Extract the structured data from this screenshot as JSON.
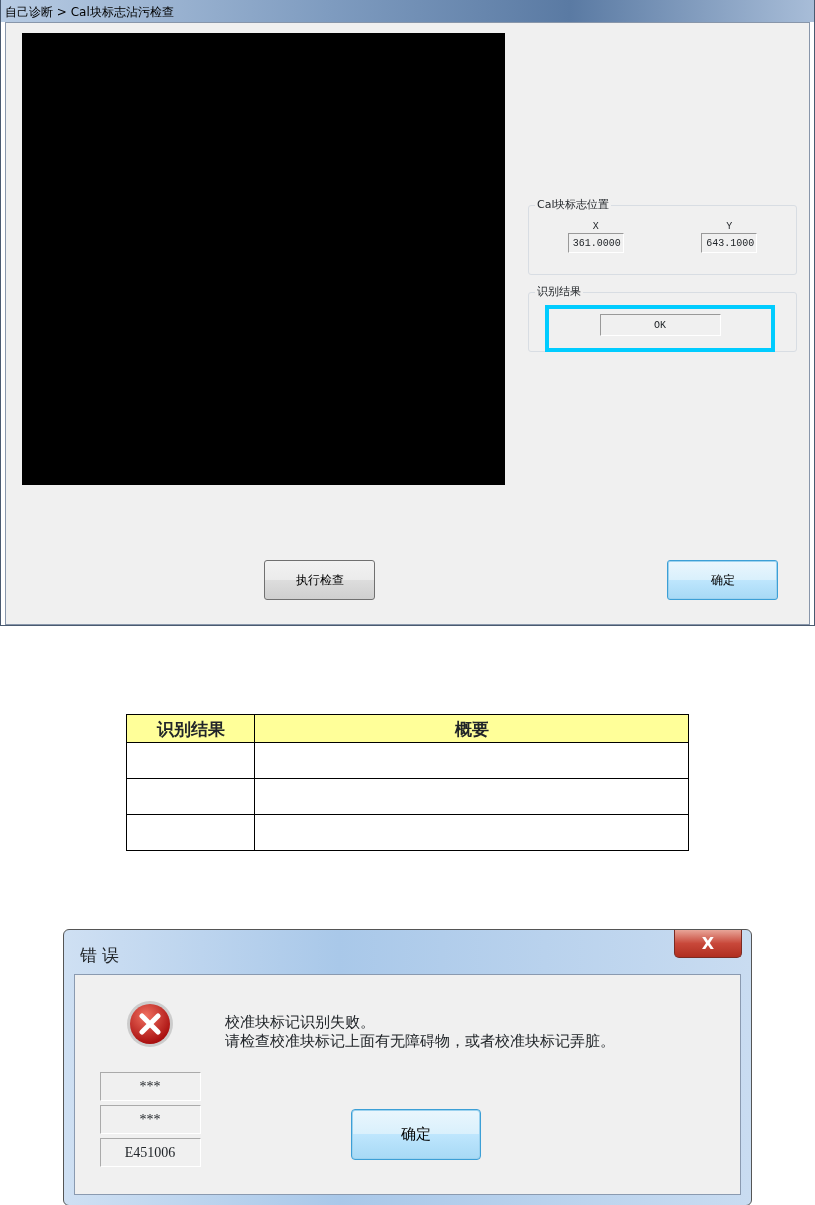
{
  "main_window": {
    "title": "自己诊断 > Cal块标志沾污检查",
    "position_group": {
      "label": "Cal块标志位置",
      "fields": [
        {
          "label": "X",
          "value": "361.0000"
        },
        {
          "label": "Y",
          "value": "643.1000"
        }
      ]
    },
    "result_group": {
      "label": "识别结果",
      "value": "OK",
      "highlighted": true
    },
    "buttons": [
      {
        "label": "执行检查",
        "default": false
      },
      {
        "label": "确定",
        "default": true
      }
    ]
  },
  "table": {
    "columns": [
      "识别结果",
      "概要"
    ],
    "rows": [
      {
        "kind": "blank"
      },
      {
        "kind": "blank"
      },
      {
        "kind": "blank"
      }
    ]
  },
  "error_dialog": {
    "title": "错 误",
    "close": "X",
    "message": [
      "校准块标记识别失败。",
      "请检查校准块标记上面有无障碍物，或者校准块标记弄脏。"
    ],
    "codes": [
      "***",
      "***",
      "E451006"
    ],
    "buttons": [
      {
        "label": "确定",
        "default": true
      }
    ]
  }
}
